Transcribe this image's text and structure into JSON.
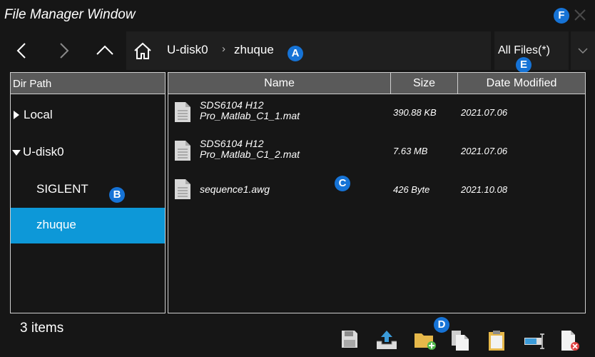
{
  "window": {
    "title": "File Manager Window"
  },
  "badges": {
    "a": "A",
    "b": "B",
    "c": "C",
    "d": "D",
    "e": "E",
    "f": "F"
  },
  "nav": {
    "back_icon": "chevron-left-icon",
    "forward_icon": "chevron-right-icon",
    "up_icon": "chevron-up-icon",
    "home_icon": "home-icon",
    "path": [
      "U-disk0",
      "zhuque"
    ],
    "separator": "›"
  },
  "filter": {
    "label": "All Files(*)"
  },
  "dir_panel": {
    "header": "Dir Path",
    "items": [
      {
        "label": "Local",
        "expanded": false
      },
      {
        "label": "U-disk0",
        "expanded": true
      },
      {
        "label": "SIGLENT"
      },
      {
        "label": "zhuque",
        "selected": true
      }
    ]
  },
  "file_panel": {
    "columns": [
      "Name",
      "Size",
      "Date Modified"
    ],
    "rows": [
      {
        "name_line1": "SDS6104 H12",
        "name_line2": "Pro_Matlab_C1_1.mat",
        "size": "390.88 KB",
        "date": "2021.07.06"
      },
      {
        "name_line1": "SDS6104 H12",
        "name_line2": "Pro_Matlab_C1_2.mat",
        "size": "7.63 MB",
        "date": "2021.07.06"
      },
      {
        "name_line1": "sequence1.awg",
        "name_line2": "",
        "size": "426 Byte",
        "date": "2021.10.08"
      }
    ]
  },
  "status": {
    "items_count": "3 items"
  },
  "toolbar": {
    "tools": [
      "save-icon",
      "load-icon",
      "new-folder-icon",
      "copy-icon",
      "paste-icon",
      "rename-icon",
      "delete-icon"
    ]
  },
  "colors": {
    "accent": "#0d98d8",
    "badge": "#1673d6",
    "header_bg": "#5a5a5a",
    "background": "#161616"
  }
}
